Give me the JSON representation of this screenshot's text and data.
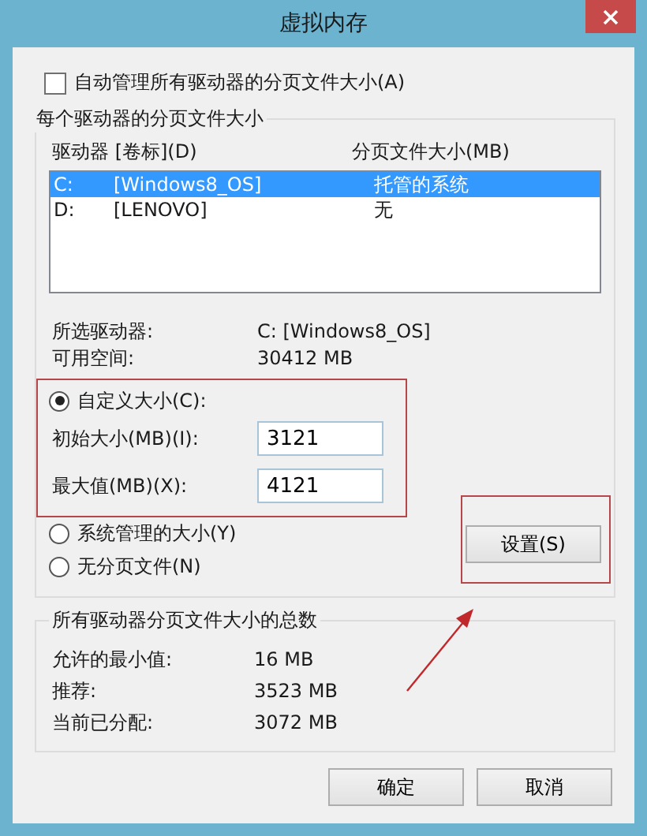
{
  "window": {
    "title": "虚拟内存"
  },
  "auto_manage": {
    "label": "自动管理所有驱动器的分页文件大小(A)",
    "checked": false
  },
  "per_drive": {
    "title": "每个驱动器的分页文件大小",
    "columns": [
      "驱动器 [卷标](D)",
      "分页文件大小(MB)"
    ],
    "drives": [
      {
        "drive": "C:",
        "label": "[Windows8_OS]",
        "paging": "托管的系统",
        "selected": true
      },
      {
        "drive": "D:",
        "label": "[LENOVO]",
        "paging": "无",
        "selected": false
      }
    ]
  },
  "selected_drive": {
    "label": "所选驱动器:",
    "value": "C:  [Windows8_OS]"
  },
  "free_space": {
    "label": "可用空间:",
    "value": "30412 MB"
  },
  "options": [
    {
      "label": "自定义大小(C):",
      "selected": true
    },
    {
      "label": "系统管理的大小(Y)",
      "selected": false
    },
    {
      "label": "无分页文件(N)",
      "selected": false
    }
  ],
  "initial_size": {
    "label": "初始大小(MB)(I):",
    "value": "3121"
  },
  "max_size": {
    "label": "最大值(MB)(X):",
    "value": "4121"
  },
  "set_button": "设置(S)",
  "totals": {
    "title": "所有驱动器分页文件大小的总数",
    "rows": [
      {
        "label": "允许的最小值:",
        "value": "16 MB"
      },
      {
        "label": "推荐:",
        "value": "3523 MB"
      },
      {
        "label": "当前已分配:",
        "value": "3072 MB"
      }
    ]
  },
  "buttons": [
    "确定",
    "取消"
  ]
}
